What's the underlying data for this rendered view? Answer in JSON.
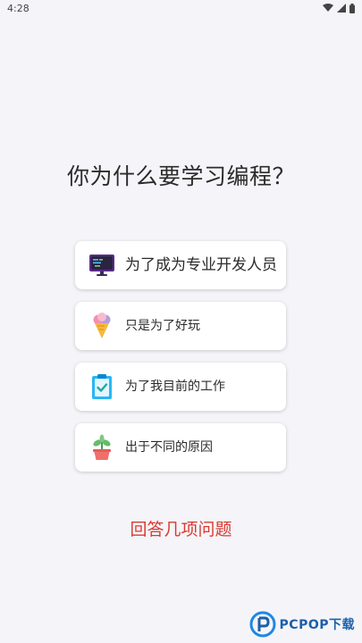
{
  "status_bar": {
    "time": "4:28"
  },
  "question": "你为什么要学习编程？",
  "options": [
    {
      "label": "为了成为专业开发人员",
      "icon": "computer-monitor-icon"
    },
    {
      "label": "只是为了好玩",
      "icon": "ice-cream-icon"
    },
    {
      "label": "为了我目前的工作",
      "icon": "clipboard-check-icon"
    },
    {
      "label": "出于不同的原因",
      "icon": "potted-plant-icon"
    }
  ],
  "answer_link": "回答几项问题",
  "watermark": "PCPOP下载",
  "colors": {
    "accent_red": "#d83a32",
    "background": "#f5f5f9"
  }
}
